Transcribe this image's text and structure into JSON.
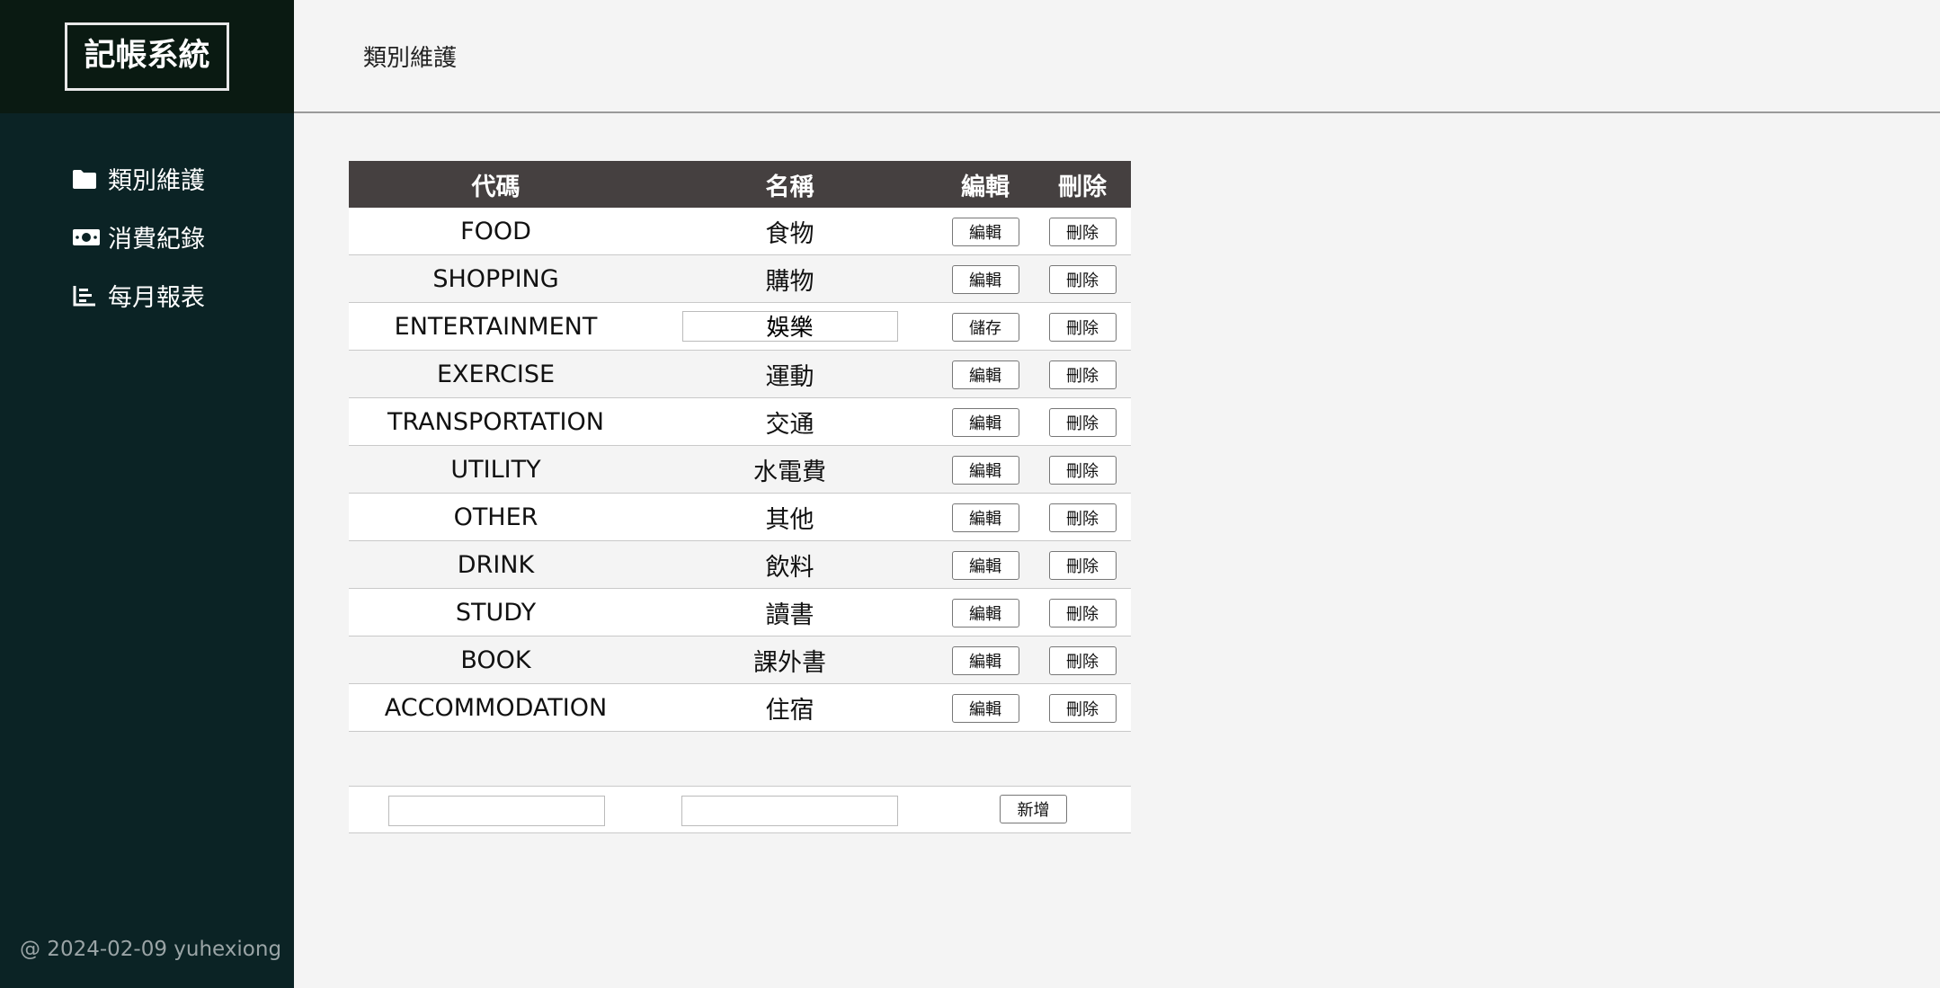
{
  "app": {
    "brand": "記帳系統"
  },
  "sidebar": {
    "items": [
      {
        "label": "類別維護",
        "icon": "folder-icon"
      },
      {
        "label": "消費紀錄",
        "icon": "money-icon"
      },
      {
        "label": "每月報表",
        "icon": "bar-chart-icon"
      }
    ],
    "footer": "@ 2024-02-09 yuhexiong"
  },
  "header": {
    "title": "類別維護"
  },
  "table": {
    "columns": [
      "代碼",
      "名稱",
      "編輯",
      "刪除"
    ],
    "rows": [
      {
        "code": "FOOD",
        "name": "食物",
        "edit": "編輯",
        "delete": "刪除"
      },
      {
        "code": "SHOPPING",
        "name": "購物",
        "edit": "編輯",
        "delete": "刪除"
      },
      {
        "code": "ENTERTAINMENT",
        "name": "娛樂",
        "edit": "儲存",
        "delete": "刪除",
        "editing": true
      },
      {
        "code": "EXERCISE",
        "name": "運動",
        "edit": "編輯",
        "delete": "刪除"
      },
      {
        "code": "TRANSPORTATION",
        "name": "交通",
        "edit": "編輯",
        "delete": "刪除"
      },
      {
        "code": "UTILITY",
        "name": "水電費",
        "edit": "編輯",
        "delete": "刪除"
      },
      {
        "code": "OTHER",
        "name": "其他",
        "edit": "編輯",
        "delete": "刪除"
      },
      {
        "code": "DRINK",
        "name": "飲料",
        "edit": "編輯",
        "delete": "刪除"
      },
      {
        "code": "STUDY",
        "name": "讀書",
        "edit": "編輯",
        "delete": "刪除"
      },
      {
        "code": "BOOK",
        "name": "課外書",
        "edit": "編輯",
        "delete": "刪除"
      },
      {
        "code": "ACCOMMODATION",
        "name": "住宿",
        "edit": "編輯",
        "delete": "刪除"
      }
    ]
  },
  "add_form": {
    "code_value": "",
    "name_value": "",
    "add_label": "新增"
  },
  "colors": {
    "sidebar_bg": "#0b2325",
    "brand_bg": "#0a1a12",
    "header_bg": "#454040",
    "page_bg": "#f4f4f4"
  }
}
